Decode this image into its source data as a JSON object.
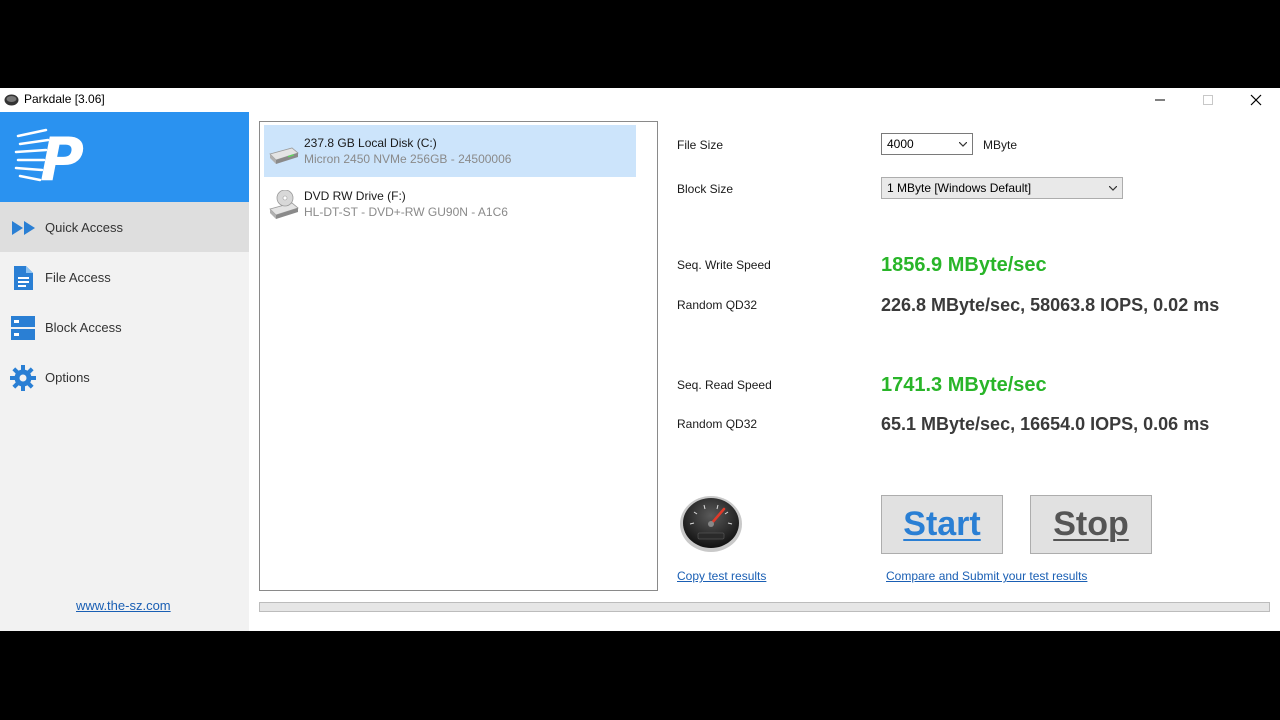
{
  "window": {
    "title": "Parkdale [3.06]",
    "controls": [
      "minimize",
      "maximize",
      "close"
    ]
  },
  "sidebar": {
    "logo_letter": "P",
    "items": [
      {
        "label": "Quick Access",
        "icon": "fast-forward-icon",
        "active": true
      },
      {
        "label": "File Access",
        "icon": "document-icon",
        "active": false
      },
      {
        "label": "Block Access",
        "icon": "server-stack-icon",
        "active": false
      },
      {
        "label": "Options",
        "icon": "gear-icon",
        "active": false
      }
    ],
    "website": "www.the-sz.com"
  },
  "drives": [
    {
      "name": "237.8 GB Local Disk (C:)",
      "detail": "Micron 2450 NVMe 256GB - 24500006",
      "icon": "hard-disk-icon",
      "selected": true
    },
    {
      "name": "DVD RW Drive (F:)",
      "detail": "HL-DT-ST - DVD+-RW GU90N - A1C6",
      "icon": "optical-drive-icon",
      "selected": false
    }
  ],
  "settings": {
    "file_size_label": "File Size",
    "file_size_value": "4000",
    "file_size_unit": "MByte",
    "block_size_label": "Block Size",
    "block_size_value": "1 MByte [Windows Default]"
  },
  "results": {
    "write": {
      "seq_label": "Seq. Write Speed",
      "seq_value": "1856.9 MByte/sec",
      "random_label": "Random QD32",
      "random_value": "226.8 MByte/sec, 58063.8 IOPS, 0.02 ms"
    },
    "read": {
      "seq_label": "Seq. Read Speed",
      "seq_value": "1741.3 MByte/sec",
      "random_label": "Random QD32",
      "random_value": "65.1 MByte/sec, 16654.0 IOPS, 0.06 ms"
    }
  },
  "actions": {
    "start_label": "Start",
    "stop_label": "Stop",
    "copy_link": "Copy test results",
    "submit_link": "Compare and Submit your test results"
  },
  "colors": {
    "accent": "#2a92f0",
    "speed_green": "#29b529",
    "start_blue": "#2a7fd4",
    "stop_grey": "#555555",
    "link_blue": "#1a5fb4"
  },
  "progress": {
    "fraction": 0
  }
}
